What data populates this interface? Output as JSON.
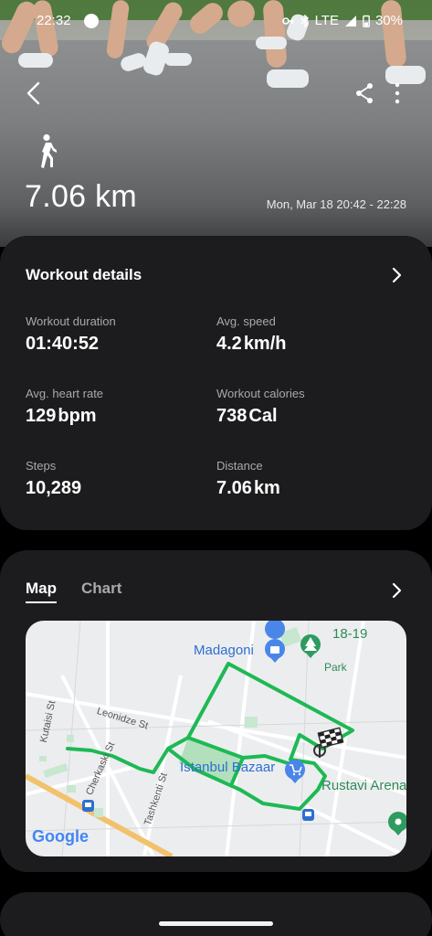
{
  "status_bar": {
    "time": "22:32",
    "network": "LTE",
    "battery": "30%"
  },
  "header": {
    "activity_icon": "walking-person-icon",
    "distance": "7.06 km",
    "date_range": "Mon, Mar 18 20:42 - 22:28"
  },
  "details": {
    "title": "Workout details",
    "duration_label": "Workout duration",
    "duration_value": "01:40:52",
    "speed_label": "Avg. speed",
    "speed_value": "4.2",
    "speed_unit": "km/h",
    "hr_label": "Avg. heart rate",
    "hr_value": "129",
    "hr_unit": "bpm",
    "cal_label": "Workout calories",
    "cal_value": "738",
    "cal_unit": "Cal",
    "steps_label": "Steps",
    "steps_value": "10,289",
    "dist_label": "Distance",
    "dist_value": "7.06",
    "dist_unit": "km"
  },
  "map_section": {
    "tabs": [
      "Map",
      "Chart"
    ],
    "labels": {
      "madagoni": "Madagoni",
      "n1819": "18-19",
      "park": "Park",
      "istanbul": "Istanbul Bazaar",
      "rustavi": "Rustavi Arena",
      "google": "Google"
    },
    "streets": {
      "kutaisi": "Kutaisi St",
      "leonidze": "Leonidze St",
      "cherkaski": "Cherkaski St",
      "tashkenti": "Tashkenti St"
    },
    "colors": {
      "route": "#1db954",
      "poi_blue": "#4a86e8",
      "poi_green": "#2e9b5f"
    }
  }
}
